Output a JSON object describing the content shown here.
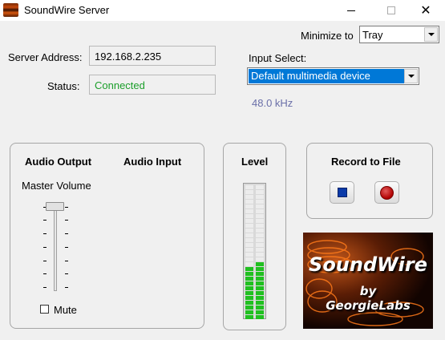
{
  "window": {
    "title": "SoundWire Server",
    "close_glyph": "✕"
  },
  "minimize": {
    "label": "Minimize to",
    "selected": "Tray"
  },
  "server": {
    "address_label": "Server Address:",
    "address_value": "192.168.2.235",
    "status_label": "Status:",
    "status_value": "Connected",
    "status_color": "#1b9e2a"
  },
  "input": {
    "label": "Input Select:",
    "selected": "Default multimedia device",
    "sample_rate": "48.0 kHz"
  },
  "audio": {
    "output_heading": "Audio Output",
    "input_heading": "Audio Input",
    "master_volume_label": "Master Volume",
    "master_volume_level": 1.0,
    "mute_label": "Mute",
    "mute_checked": false
  },
  "level": {
    "heading": "Level",
    "left_channel": 0.38,
    "right_channel": 0.43
  },
  "record": {
    "heading": "Record to File",
    "stop_icon": "stop-icon",
    "record_icon": "record-icon"
  },
  "logo": {
    "line1": "SoundWire",
    "line2": "by",
    "line3": "GeorgieLabs"
  },
  "colors": {
    "accent": "#0078d7",
    "meter_green": "#20c020",
    "rate_text": "#6a6fa8"
  }
}
